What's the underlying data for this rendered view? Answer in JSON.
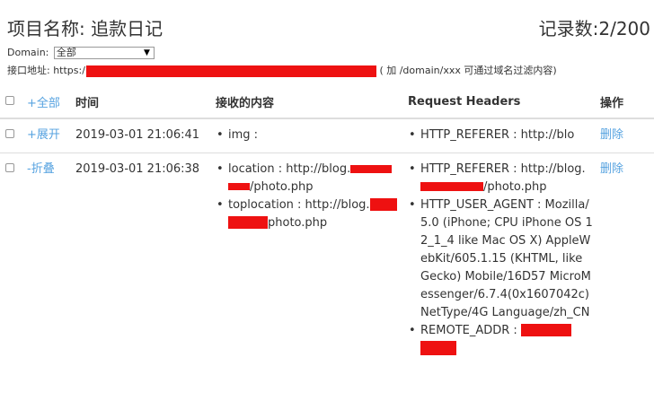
{
  "header": {
    "title": "项目名称: 追款日记",
    "record_count": "记录数:2/200"
  },
  "filter": {
    "domain_label": "Domain:",
    "domain_value": "全部",
    "api_label": "接口地址: https:/",
    "api_suffix": "( 加 /domain/xxx 可通过域名过滤内容)"
  },
  "table": {
    "headers": {
      "toggle_all": "+全部",
      "time": "时间",
      "received": "接收的内容",
      "request_headers": "Request Headers",
      "actions": "操作"
    },
    "rows": [
      {
        "toggle": "+展开",
        "time": "2019-03-01 21:06:41",
        "received": [
          "img :"
        ],
        "headers": [
          "HTTP_REFERER : http://blo"
        ],
        "delete": "删除"
      },
      {
        "toggle": "-折叠",
        "time": "2019-03-01 21:06:38",
        "received": {
          "location_prefix": "location : http://blog.",
          "location_suffix": "/photo.php",
          "toplocation_prefix": "toplocation : http://blog.",
          "toplocation_suffix": "photo.php"
        },
        "headers": {
          "referer_prefix": "HTTP_REFERER : http://blog.",
          "referer_suffix": "/photo.php",
          "user_agent": "HTTP_USER_AGENT : Mozilla/5.0 (iPhone; CPU iPhone OS 12_1_4 like Mac OS X) AppleWebKit/605.1.15 (KHTML, like Gecko) Mobile/16D57 MicroMessenger/6.7.4(0x1607042c) NetType/4G Language/zh_CN",
          "remote_addr": "REMOTE_ADDR :"
        },
        "delete": "删除"
      }
    ]
  },
  "colors": {
    "link": "#57a3e0",
    "redaction": "#ee1111",
    "border": "#dddddd"
  },
  "icons": {
    "select_arrow": "chevron-down-icon"
  }
}
